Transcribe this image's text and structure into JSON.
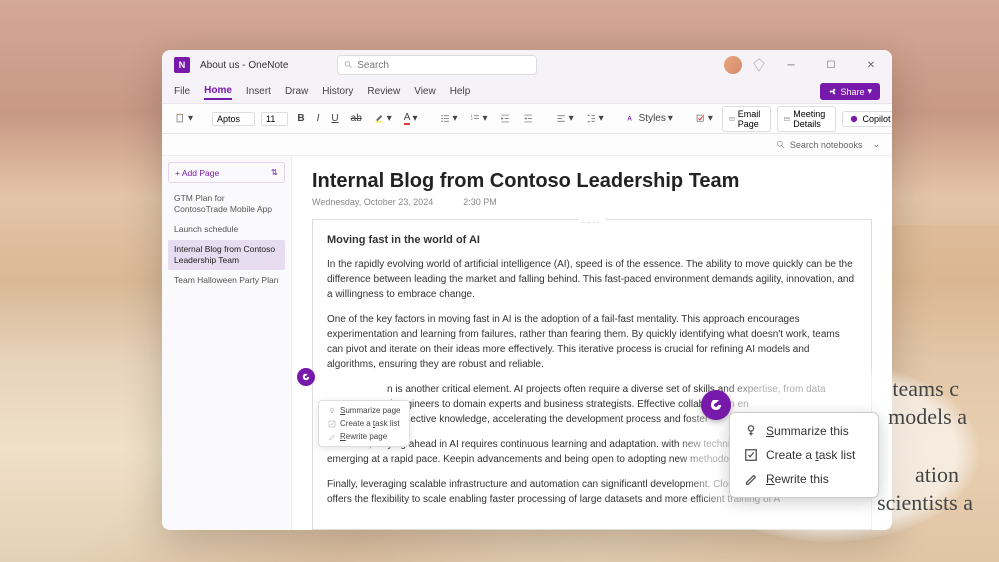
{
  "window": {
    "title": "About us - OneNote"
  },
  "search": {
    "placeholder": "Search"
  },
  "menus": {
    "file": "File",
    "home": "Home",
    "insert": "Insert",
    "draw": "Draw",
    "history": "History",
    "review": "Review",
    "view": "View",
    "help": "Help"
  },
  "share": "Share",
  "toolbar": {
    "font": "Aptos",
    "size": "11",
    "styles": "Styles",
    "email": "Email Page",
    "meeting": "Meeting Details",
    "copilot": "Copilot"
  },
  "search_notebooks": "Search notebooks",
  "sidebar": {
    "add": "Add Page",
    "items": [
      "GTM Plan for ContosoTrade Mobile App",
      "Launch schedule",
      "Internal Blog from Contoso Leadership Team",
      "Team Halloween Party Plan"
    ]
  },
  "page": {
    "title": "Internal Blog from Contoso Leadership Team",
    "date": "Wednesday, October 23, 2024",
    "time": "2:30 PM",
    "heading": "Moving fast in the world of AI",
    "p1": "In the rapidly evolving world of artificial intelligence (AI), speed is of the essence. The ability to move quickly can be the difference between leading the market and falling behind. This fast-paced environment demands agility, innovation, and a willingness to embrace change.",
    "p2": "One of the key factors in moving fast in AI is the adoption of a fail-fast mentality. This approach encourages experimentation and learning from failures, rather than fearing them. By quickly identifying what doesn't work, teams can pivot and iterate on their ideas more effectively. This iterative process is crucial for refining AI models and algorithms, ensuring they are robust and reliable.",
    "p3a": "n is another critical element. AI projects often require a diverse set of skills and expertise, from data",
    "p3b": "d engineers to domain experts and business strategists. Effective collaboration en",
    "p3c": "ir collective knowledge, accelerating the development process and foster",
    "p4": "Moreover, staying ahead in AI requires continuous learning and adaptation. with new techniques, tools, and research emerging at a rapid pace. Keepin advancements and being open to adopting new methodologies can prov",
    "p5": "Finally, leveraging scalable infrastructure and automation can significantl development. Cloud computing, for instance, offers the flexibility to scale enabling faster processing of large datasets and more efficient training of A"
  },
  "small_menu": {
    "summarize": "Summarize page",
    "tasklist": "Create a task list",
    "rewrite": "Rewrite page"
  },
  "zoom": {
    "bg1": "teams c",
    "bg2": "models a",
    "bg3": "ation",
    "bg4": "scientists a",
    "summarize": "Summarize this",
    "tasklist": "Create a task list",
    "rewrite": "Rewrite this"
  }
}
